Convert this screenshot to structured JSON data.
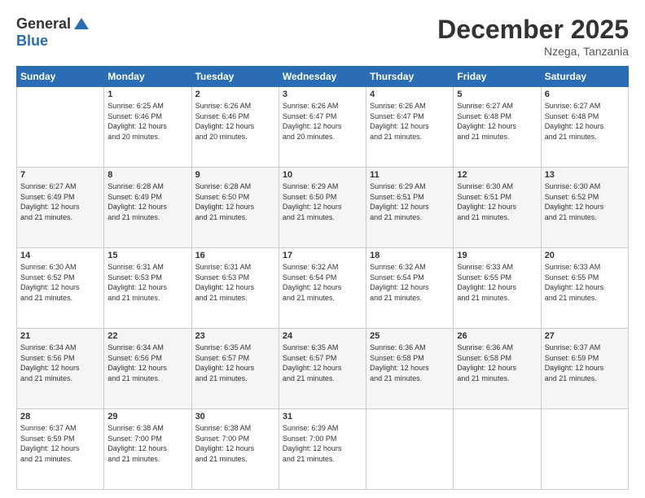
{
  "logo": {
    "general": "General",
    "blue": "Blue"
  },
  "header": {
    "month": "December 2025",
    "location": "Nzega, Tanzania"
  },
  "weekdays": [
    "Sunday",
    "Monday",
    "Tuesday",
    "Wednesday",
    "Thursday",
    "Friday",
    "Saturday"
  ],
  "weeks": [
    [
      {
        "day": "",
        "text": ""
      },
      {
        "day": "1",
        "text": "Sunrise: 6:25 AM\nSunset: 6:46 PM\nDaylight: 12 hours\nand 20 minutes."
      },
      {
        "day": "2",
        "text": "Sunrise: 6:26 AM\nSunset: 6:46 PM\nDaylight: 12 hours\nand 20 minutes."
      },
      {
        "day": "3",
        "text": "Sunrise: 6:26 AM\nSunset: 6:47 PM\nDaylight: 12 hours\nand 20 minutes."
      },
      {
        "day": "4",
        "text": "Sunrise: 6:26 AM\nSunset: 6:47 PM\nDaylight: 12 hours\nand 21 minutes."
      },
      {
        "day": "5",
        "text": "Sunrise: 6:27 AM\nSunset: 6:48 PM\nDaylight: 12 hours\nand 21 minutes."
      },
      {
        "day": "6",
        "text": "Sunrise: 6:27 AM\nSunset: 6:48 PM\nDaylight: 12 hours\nand 21 minutes."
      }
    ],
    [
      {
        "day": "7",
        "text": "Sunrise: 6:27 AM\nSunset: 6:49 PM\nDaylight: 12 hours\nand 21 minutes."
      },
      {
        "day": "8",
        "text": "Sunrise: 6:28 AM\nSunset: 6:49 PM\nDaylight: 12 hours\nand 21 minutes."
      },
      {
        "day": "9",
        "text": "Sunrise: 6:28 AM\nSunset: 6:50 PM\nDaylight: 12 hours\nand 21 minutes."
      },
      {
        "day": "10",
        "text": "Sunrise: 6:29 AM\nSunset: 6:50 PM\nDaylight: 12 hours\nand 21 minutes."
      },
      {
        "day": "11",
        "text": "Sunrise: 6:29 AM\nSunset: 6:51 PM\nDaylight: 12 hours\nand 21 minutes."
      },
      {
        "day": "12",
        "text": "Sunrise: 6:30 AM\nSunset: 6:51 PM\nDaylight: 12 hours\nand 21 minutes."
      },
      {
        "day": "13",
        "text": "Sunrise: 6:30 AM\nSunset: 6:52 PM\nDaylight: 12 hours\nand 21 minutes."
      }
    ],
    [
      {
        "day": "14",
        "text": "Sunrise: 6:30 AM\nSunset: 6:52 PM\nDaylight: 12 hours\nand 21 minutes."
      },
      {
        "day": "15",
        "text": "Sunrise: 6:31 AM\nSunset: 6:53 PM\nDaylight: 12 hours\nand 21 minutes."
      },
      {
        "day": "16",
        "text": "Sunrise: 6:31 AM\nSunset: 6:53 PM\nDaylight: 12 hours\nand 21 minutes."
      },
      {
        "day": "17",
        "text": "Sunrise: 6:32 AM\nSunset: 6:54 PM\nDaylight: 12 hours\nand 21 minutes."
      },
      {
        "day": "18",
        "text": "Sunrise: 6:32 AM\nSunset: 6:54 PM\nDaylight: 12 hours\nand 21 minutes."
      },
      {
        "day": "19",
        "text": "Sunrise: 6:33 AM\nSunset: 6:55 PM\nDaylight: 12 hours\nand 21 minutes."
      },
      {
        "day": "20",
        "text": "Sunrise: 6:33 AM\nSunset: 6:55 PM\nDaylight: 12 hours\nand 21 minutes."
      }
    ],
    [
      {
        "day": "21",
        "text": "Sunrise: 6:34 AM\nSunset: 6:56 PM\nDaylight: 12 hours\nand 21 minutes."
      },
      {
        "day": "22",
        "text": "Sunrise: 6:34 AM\nSunset: 6:56 PM\nDaylight: 12 hours\nand 21 minutes."
      },
      {
        "day": "23",
        "text": "Sunrise: 6:35 AM\nSunset: 6:57 PM\nDaylight: 12 hours\nand 21 minutes."
      },
      {
        "day": "24",
        "text": "Sunrise: 6:35 AM\nSunset: 6:57 PM\nDaylight: 12 hours\nand 21 minutes."
      },
      {
        "day": "25",
        "text": "Sunrise: 6:36 AM\nSunset: 6:58 PM\nDaylight: 12 hours\nand 21 minutes."
      },
      {
        "day": "26",
        "text": "Sunrise: 6:36 AM\nSunset: 6:58 PM\nDaylight: 12 hours\nand 21 minutes."
      },
      {
        "day": "27",
        "text": "Sunrise: 6:37 AM\nSunset: 6:59 PM\nDaylight: 12 hours\nand 21 minutes."
      }
    ],
    [
      {
        "day": "28",
        "text": "Sunrise: 6:37 AM\nSunset: 6:59 PM\nDaylight: 12 hours\nand 21 minutes."
      },
      {
        "day": "29",
        "text": "Sunrise: 6:38 AM\nSunset: 7:00 PM\nDaylight: 12 hours\nand 21 minutes."
      },
      {
        "day": "30",
        "text": "Sunrise: 6:38 AM\nSunset: 7:00 PM\nDaylight: 12 hours\nand 21 minutes."
      },
      {
        "day": "31",
        "text": "Sunrise: 6:39 AM\nSunset: 7:00 PM\nDaylight: 12 hours\nand 21 minutes."
      },
      {
        "day": "",
        "text": ""
      },
      {
        "day": "",
        "text": ""
      },
      {
        "day": "",
        "text": ""
      }
    ]
  ]
}
